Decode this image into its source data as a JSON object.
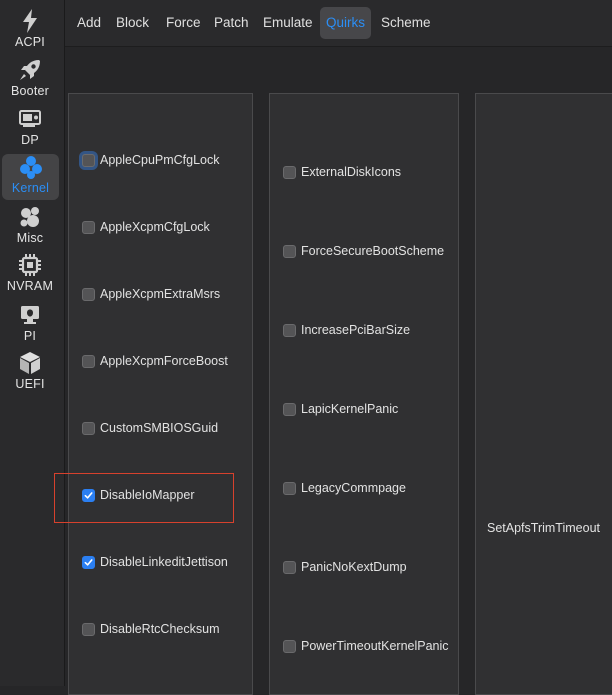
{
  "sidebar": {
    "items": [
      {
        "label": "ACPI",
        "icon": "lightning-bolt-icon",
        "active": false
      },
      {
        "label": "Booter",
        "icon": "rocket-icon",
        "active": false
      },
      {
        "label": "DP",
        "icon": "graphics-card-icon",
        "active": false
      },
      {
        "label": "Kernel",
        "icon": "kernel-icon",
        "active": true
      },
      {
        "label": "Misc",
        "icon": "misc-icon",
        "active": false
      },
      {
        "label": "NVRAM",
        "icon": "chip-icon",
        "active": false
      },
      {
        "label": "PI",
        "icon": "apple-icon",
        "active": false
      },
      {
        "label": "UEFI",
        "icon": "cube-icon",
        "active": false
      }
    ]
  },
  "tabs": [
    {
      "label": "Add",
      "active": false
    },
    {
      "label": "Block",
      "active": false
    },
    {
      "label": "Force",
      "active": false
    },
    {
      "label": "Patch",
      "active": false
    },
    {
      "label": "Emulate",
      "active": false
    },
    {
      "label": "Quirks",
      "active": true
    },
    {
      "label": "Scheme",
      "active": false
    }
  ],
  "column1": [
    {
      "label": "AppleCpuPmCfgLock",
      "checked": false
    },
    {
      "label": "AppleXcpmCfgLock",
      "checked": false
    },
    {
      "label": "AppleXcpmExtraMsrs",
      "checked": false
    },
    {
      "label": "AppleXcpmForceBoost",
      "checked": false
    },
    {
      "label": "CustomSMBIOSGuid",
      "checked": false
    },
    {
      "label": "DisableIoMapper",
      "checked": true
    },
    {
      "label": "DisableLinkeditJettison",
      "checked": true
    },
    {
      "label": "DisableRtcChecksum",
      "checked": false
    }
  ],
  "column2": [
    {
      "label": "ExternalDiskIcons",
      "checked": false
    },
    {
      "label": "ForceSecureBootScheme",
      "checked": false
    },
    {
      "label": "IncreasePciBarSize",
      "checked": false
    },
    {
      "label": "LapicKernelPanic",
      "checked": false
    },
    {
      "label": "LegacyCommpage",
      "checked": false
    },
    {
      "label": "PanicNoKextDump",
      "checked": false
    },
    {
      "label": "PowerTimeoutKernelPanic",
      "checked": false
    }
  ],
  "column3": {
    "apfs_trim_label": "SetApfsTrimTimeout"
  },
  "colors": {
    "accent": "#2b8ef5",
    "checkbox_checked": "#2b7ff2",
    "highlight_box": "#d7412d"
  }
}
